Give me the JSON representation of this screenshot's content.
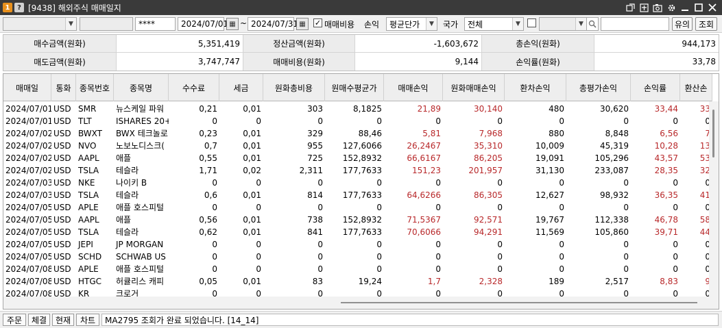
{
  "window": {
    "badge1": "1",
    "badge2": "?",
    "title": "[9438] 해외주식 매매일지"
  },
  "toolbar": {
    "date_from": "2024/07/01",
    "tilde": "~",
    "date_to": "2024/07/31",
    "password": "****",
    "fee_checkbox_label": "매매비용",
    "fee_checked": true,
    "pnl_label": "손익",
    "pnl_method": "평균단가",
    "country_label": "국가",
    "country_value": "전체",
    "btn_caution": "유의",
    "btn_query": "조회"
  },
  "summary": [
    {
      "label": "매수금액(원화)",
      "value": "5,351,419"
    },
    {
      "label": "정산금액(원화)",
      "value": "-1,603,672"
    },
    {
      "label": "총손익(원화)",
      "value": "944,173"
    },
    {
      "label": "매도금액(원화)",
      "value": "3,747,747"
    },
    {
      "label": "매매비용(원화)",
      "value": "9,144"
    },
    {
      "label": "손익률(원화)",
      "value": "33,78"
    }
  ],
  "table": {
    "headers": [
      "매매일",
      "통화",
      "종목번호",
      "종목명",
      "수수료",
      "세금",
      "원화총비용",
      "원매수평균가",
      "매매손익",
      "원화매매손익",
      "환차손익",
      "총평가손익",
      "손익률",
      "환산손"
    ],
    "rows": [
      [
        "2024/07/01",
        "USD",
        "SMR",
        "뉴스케일 파워",
        "0,21",
        "0,01",
        "303",
        "8,1825",
        "21,89",
        "30,140",
        "480",
        "30,620",
        "33,44",
        "33"
      ],
      [
        "2024/07/01",
        "USD",
        "TLT",
        "ISHARES 20+",
        "0",
        "0",
        "0",
        "0",
        "0",
        "0",
        "0",
        "0",
        "0",
        "0"
      ],
      [
        "2024/07/02",
        "USD",
        "BWXT",
        "BWX 테크놀로",
        "0,23",
        "0,01",
        "329",
        "88,46",
        "5,81",
        "7,968",
        "880",
        "8,848",
        "6,56",
        "7"
      ],
      [
        "2024/07/02",
        "USD",
        "NVO",
        "노보노디스크(",
        "0,7",
        "0,01",
        "955",
        "127,6066",
        "26,2467",
        "35,310",
        "10,009",
        "45,319",
        "10,28",
        "13"
      ],
      [
        "2024/07/02",
        "USD",
        "AAPL",
        "애플",
        "0,55",
        "0,01",
        "725",
        "152,8932",
        "66,6167",
        "86,205",
        "19,091",
        "105,296",
        "43,57",
        "53"
      ],
      [
        "2024/07/02",
        "USD",
        "TSLA",
        "테슬라",
        "1,71",
        "0,02",
        "2,311",
        "177,7633",
        "151,23",
        "201,957",
        "31,130",
        "233,087",
        "28,35",
        "32"
      ],
      [
        "2024/07/03",
        "USD",
        "NKE",
        "나이키 B",
        "0",
        "0",
        "0",
        "0",
        "0",
        "0",
        "0",
        "0",
        "0",
        "0"
      ],
      [
        "2024/07/03",
        "USD",
        "TSLA",
        "테슬라",
        "0,6",
        "0,01",
        "814",
        "177,7633",
        "64,6266",
        "86,305",
        "12,627",
        "98,932",
        "36,35",
        "41"
      ],
      [
        "2024/07/05",
        "USD",
        "APLE",
        "애플 호스피털",
        "0",
        "0",
        "0",
        "0",
        "0",
        "0",
        "0",
        "0",
        "0",
        "0"
      ],
      [
        "2024/07/05",
        "USD",
        "AAPL",
        "애플",
        "0,56",
        "0,01",
        "738",
        "152,8932",
        "71,5367",
        "92,571",
        "19,767",
        "112,338",
        "46,78",
        "58"
      ],
      [
        "2024/07/05",
        "USD",
        "TSLA",
        "테슬라",
        "0,62",
        "0,01",
        "841",
        "177,7633",
        "70,6066",
        "94,291",
        "11,569",
        "105,860",
        "39,71",
        "44"
      ],
      [
        "2024/07/05",
        "USD",
        "JEPI",
        "JP MORGAN",
        "0",
        "0",
        "0",
        "0",
        "0",
        "0",
        "0",
        "0",
        "0",
        "0"
      ],
      [
        "2024/07/05",
        "USD",
        "SCHD",
        "SCHWAB US",
        "0",
        "0",
        "0",
        "0",
        "0",
        "0",
        "0",
        "0",
        "0",
        "0"
      ],
      [
        "2024/07/08",
        "USD",
        "APLE",
        "애플 호스피털",
        "0",
        "0",
        "0",
        "0",
        "0",
        "0",
        "0",
        "0",
        "0",
        "0"
      ],
      [
        "2024/07/08",
        "USD",
        "HTGC",
        "허큘리스 캐피",
        "0,05",
        "0,01",
        "83",
        "19,24",
        "1,7",
        "2,328",
        "189",
        "2,517",
        "8,83",
        "9"
      ],
      [
        "2024/07/08",
        "USD",
        "KR",
        "크로거",
        "0",
        "0",
        "0",
        "0",
        "0",
        "0",
        "0",
        "0",
        "0",
        "0"
      ]
    ]
  },
  "statusbar": {
    "btn_order": "주문",
    "btn_fill": "체결",
    "btn_current": "현재",
    "btn_chart": "차트",
    "message": "MA2795 조회가 완료 되었습니다. [14_14]"
  },
  "colors": {
    "title_bg": "#3a3a3a",
    "badge_orange": "#e8901c",
    "profit_red": "#b8282a",
    "header_bg": "#eeeeee"
  }
}
